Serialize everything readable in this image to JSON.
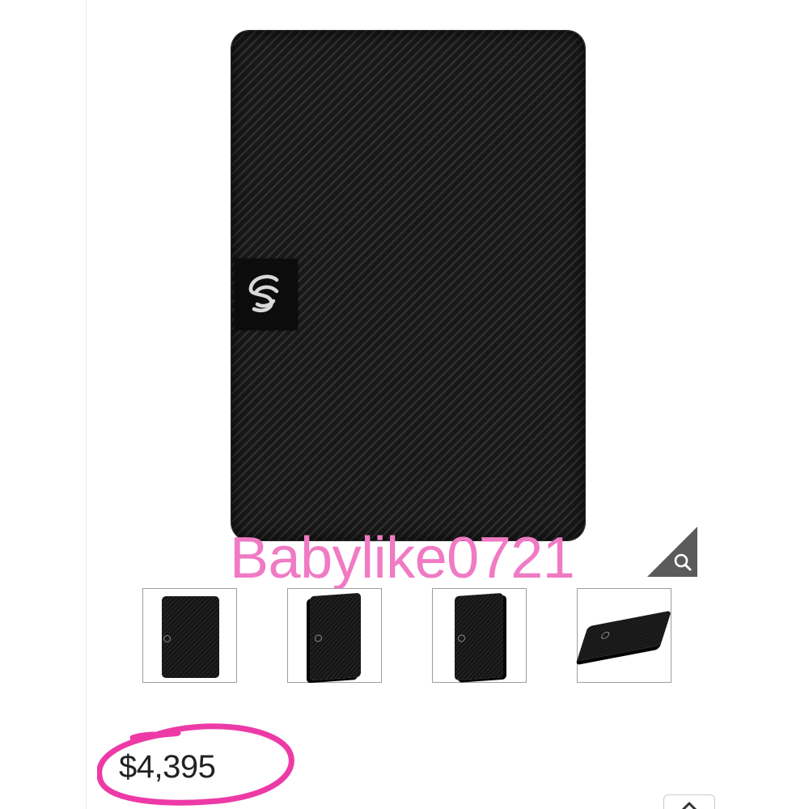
{
  "product": {
    "main_image_alt": "",
    "thumbnails": [
      {
        "view": "front"
      },
      {
        "view": "angled-left"
      },
      {
        "view": "angled-right"
      },
      {
        "view": "flat"
      }
    ],
    "price": "$4,395"
  },
  "watermark": {
    "text": "Babylike0721",
    "color": "#f07ac4"
  },
  "annotation": {
    "shape": "hand-drawn-circle",
    "color": "#ee3aa6"
  },
  "icons": {
    "zoom": "magnifier-icon",
    "scroll_top": "chevron-up-icon",
    "brand_logo": "seagate-logo-icon"
  }
}
